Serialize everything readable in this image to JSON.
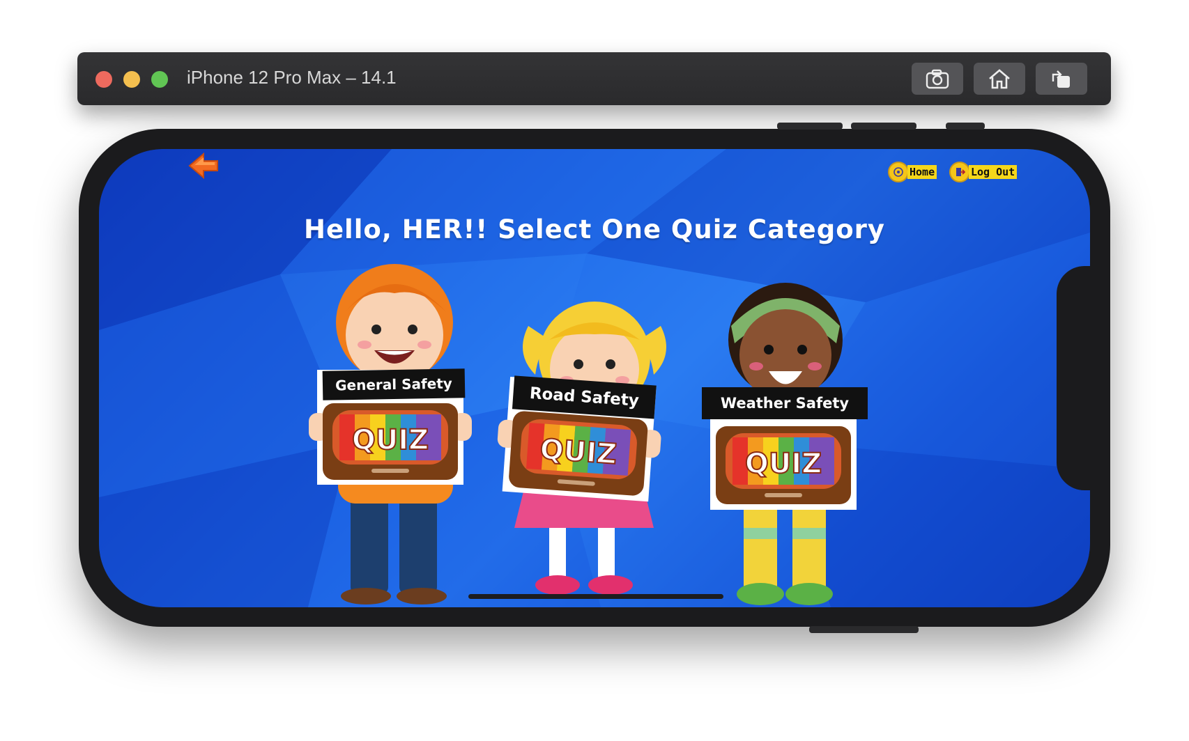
{
  "simulator": {
    "title": "iPhone 12 Pro Max – 14.1",
    "toolbar": [
      "screenshot",
      "home",
      "rotate"
    ]
  },
  "nav": {
    "home_label": "Home",
    "logout_label": "Log Out"
  },
  "page": {
    "title": "Hello, HER!! Select One Quiz Category"
  },
  "categories": [
    {
      "label": "General Safety",
      "card_text": "QUIZ"
    },
    {
      "label": "Road Safety",
      "card_text": "QUIZ"
    },
    {
      "label": "Weather Safety",
      "card_text": "QUIZ"
    }
  ],
  "colors": {
    "background": "#1f6ae9",
    "nav_badge": "#f5d71a",
    "back_arrow": "#f26b21"
  }
}
